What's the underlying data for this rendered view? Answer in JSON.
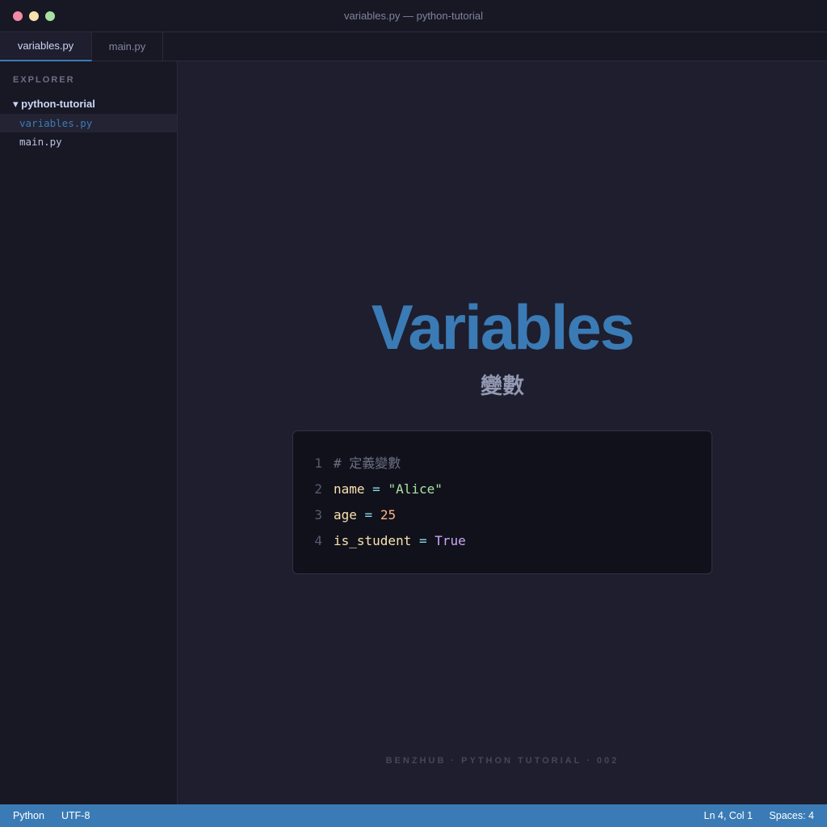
{
  "window": {
    "title": "variables.py — python-tutorial"
  },
  "tabs": [
    {
      "label": "variables.py",
      "active": true
    },
    {
      "label": "main.py",
      "active": false
    }
  ],
  "sidebar": {
    "title": "EXPLORER",
    "folder": "▾ python-tutorial",
    "files": [
      {
        "label": "variables.py",
        "selected": true
      },
      {
        "label": "main.py",
        "selected": false
      }
    ]
  },
  "hero": {
    "title": "Variables",
    "subtitle": "變數"
  },
  "code": {
    "lines": [
      {
        "number": "1",
        "tokens": [
          {
            "text": "# 定義變數",
            "kind": "comment"
          }
        ]
      },
      {
        "number": "2",
        "tokens": [
          {
            "text": "name",
            "kind": "var"
          },
          {
            "text": " = ",
            "kind": "op"
          },
          {
            "text": "\"Alice\"",
            "kind": "str"
          }
        ]
      },
      {
        "number": "3",
        "tokens": [
          {
            "text": "age",
            "kind": "var"
          },
          {
            "text": " = ",
            "kind": "op"
          },
          {
            "text": "25",
            "kind": "num"
          }
        ]
      },
      {
        "number": "4",
        "tokens": [
          {
            "text": "is_student",
            "kind": "var"
          },
          {
            "text": " = ",
            "kind": "op"
          },
          {
            "text": "True",
            "kind": "kw"
          }
        ]
      }
    ]
  },
  "footer": {
    "credit": "BENZHUB · PYTHON TUTORIAL · 002"
  },
  "statusbar": {
    "language": "Python",
    "encoding": "UTF-8",
    "position": "Ln 4, Col 1",
    "spaces": "Spaces: 4"
  },
  "colors": {
    "accent": "#3b7bb5",
    "background": "#1e1e2e",
    "sidebar": "#181825"
  }
}
